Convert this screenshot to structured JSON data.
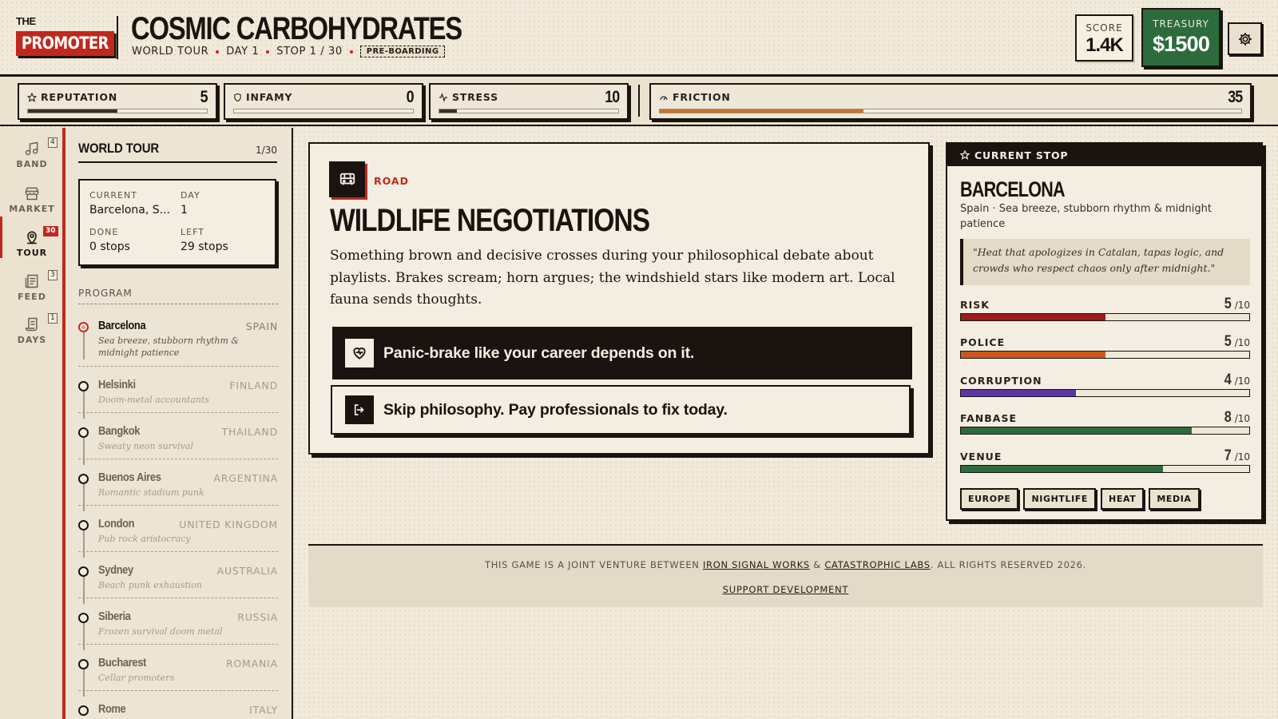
{
  "logo": {
    "the": "THE",
    "name": "PROMOTER"
  },
  "band": {
    "name": "COSMIC CARBOHYDRATES"
  },
  "subtitle": {
    "tour": "WORLD TOUR",
    "day": "DAY 1",
    "stop": "STOP 1 / 30",
    "phase": "PRE-BOARDING"
  },
  "score": {
    "label": "SCORE",
    "value": "1.4K"
  },
  "treasury": {
    "label": "TREASURY",
    "value": "$1500"
  },
  "stats": [
    {
      "name": "REPUTATION",
      "value": "5",
      "fill": 0.5,
      "icon": "star-icon"
    },
    {
      "name": "INFAMY",
      "value": "0",
      "fill": 0,
      "icon": "shield-icon"
    },
    {
      "name": "STRESS",
      "value": "10",
      "fill": 0.1,
      "icon": "pulse-icon"
    },
    {
      "name": "FRICTION",
      "value": "35",
      "fill": 0.35,
      "icon": "gauge-icon"
    }
  ],
  "rail": [
    {
      "label": "BAND",
      "count": "4",
      "icon": "music-icon"
    },
    {
      "label": "MARKET",
      "count": "",
      "icon": "store-icon"
    },
    {
      "label": "TOUR",
      "count": "30",
      "icon": "pin-icon"
    },
    {
      "label": "FEED",
      "count": "3",
      "icon": "feed-icon"
    },
    {
      "label": "DAYS",
      "count": "1",
      "icon": "scroll-icon"
    }
  ],
  "tour": {
    "title": "WORLD TOUR",
    "count": "1/30",
    "current_label": "CURRENT",
    "current_value": "Barcelona, S...",
    "day_label": "DAY",
    "day_value": "1",
    "done_label": "DONE",
    "done_value": "0 stops",
    "left_label": "LEFT",
    "left_value": "29 stops",
    "program_label": "PROGRAM",
    "stops": [
      {
        "city": "Barcelona",
        "country": "SPAIN",
        "tagline": "Sea breeze, stubborn rhythm & midnight patience"
      },
      {
        "city": "Helsinki",
        "country": "FINLAND",
        "tagline": "Doom-metal accountants"
      },
      {
        "city": "Bangkok",
        "country": "THAILAND",
        "tagline": "Sweaty neon survival"
      },
      {
        "city": "Buenos Aires",
        "country": "ARGENTINA",
        "tagline": "Romantic stadium punk"
      },
      {
        "city": "London",
        "country": "UNITED KINGDOM",
        "tagline": "Pub rock aristocracy"
      },
      {
        "city": "Sydney",
        "country": "AUSTRALIA",
        "tagline": "Beach punk exhaustion"
      },
      {
        "city": "Siberia",
        "country": "RUSSIA",
        "tagline": "Frozen survival doom metal"
      },
      {
        "city": "Bucharest",
        "country": "ROMANIA",
        "tagline": "Cellar promoters"
      },
      {
        "city": "Rome",
        "country": "ITALY",
        "tagline": ""
      }
    ]
  },
  "event": {
    "kind": "ROAD",
    "title": "WILDLIFE NEGOTIATIONS",
    "description": "Something brown and decisive crosses during your philosophical debate about playlists. Brakes scream; horn argues; the windshield stars like modern art. Local fauna sends thoughts.",
    "choices": [
      {
        "label": "Panic-brake like your career depends on it.",
        "icon": "heart-icon"
      },
      {
        "label": "Skip philosophy. Pay professionals to fix today.",
        "icon": "exit-icon"
      }
    ]
  },
  "current_stop": {
    "header": "CURRENT STOP",
    "city": "BARCELONA",
    "subtitle": "Spain · Sea breeze, stubborn rhythm & midnight patience",
    "quote": "\"Heat that apologizes in Catalan, tapas logic, and crowds who respect chaos only after midnight.\"",
    "max_label": "/10",
    "meters": [
      {
        "label": "RISK",
        "value": 5,
        "color": "#9b1c1c"
      },
      {
        "label": "POLICE",
        "value": 5,
        "color": "#c9581c"
      },
      {
        "label": "CORRUPTION",
        "value": 4,
        "color": "#5b36a6"
      },
      {
        "label": "FANBASE",
        "value": 8,
        "color": "#2d6b3c"
      },
      {
        "label": "VENUE",
        "value": 7,
        "color": "#2d6b3c"
      }
    ],
    "tags": [
      "EUROPE",
      "NIGHTLIFE",
      "HEAT",
      "MEDIA"
    ]
  },
  "footer": {
    "prefix": "THIS GAME IS A JOINT VENTURE BETWEEN ",
    "link1": "IRON SIGNAL WORKS",
    "amp": " & ",
    "link2": "CATASTROPHIC LABS",
    "suffix": ". ALL RIGHTS RESERVED 2026.",
    "support": "SUPPORT DEVELOPMENT"
  },
  "colors": {
    "accent": "#c0281e",
    "treasury": "#2d6b3c",
    "ink": "#1a1410",
    "paper": "#f1e9da"
  }
}
